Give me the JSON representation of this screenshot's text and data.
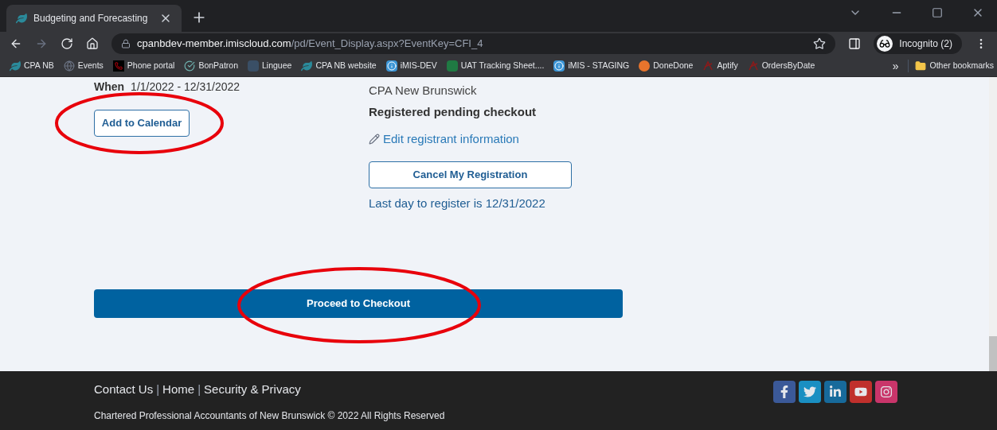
{
  "browser": {
    "tab_title": "Budgeting and Forecasting",
    "url_host": "cpanbdev-member.imiscloud.com",
    "url_path": "/pd/Event_Display.aspx?EventKey=CFI_4",
    "profile": "Incognito (2)"
  },
  "bookmarks": [
    {
      "label": "CPA NB",
      "kind": "leaf"
    },
    {
      "label": "Events",
      "kind": "globe"
    },
    {
      "label": "Phone portal",
      "kind": "phone"
    },
    {
      "label": "BonPatron",
      "kind": "check"
    },
    {
      "label": "Linguee",
      "kind": "linguee"
    },
    {
      "label": "CPA NB website",
      "kind": "leaf"
    },
    {
      "label": "iMIS-DEV",
      "kind": "info"
    },
    {
      "label": "UAT Tracking Sheet....",
      "kind": "excel"
    },
    {
      "label": "iMIS - STAGING",
      "kind": "info"
    },
    {
      "label": "DoneDone",
      "kind": "donedone"
    },
    {
      "label": "Aptify",
      "kind": "aptify"
    },
    {
      "label": "OrdersByDate",
      "kind": "aptify"
    }
  ],
  "bookmarks_overflow": "»",
  "other_bookmarks": "Other bookmarks",
  "event": {
    "when_label": "When",
    "when_value": "1/1/2022 - 12/31/2022",
    "add_to_calendar": "Add to Calendar",
    "organizer": "CPA New Brunswick",
    "status": "Registered pending checkout",
    "edit_link": "Edit registrant information",
    "cancel_button": "Cancel My Registration",
    "last_day": "Last day to register is 12/31/2022",
    "checkout_button": "Proceed to Checkout"
  },
  "footer": {
    "links": [
      "Contact Us",
      "Home",
      "Security & Privacy"
    ],
    "separator": "|",
    "copyright": "Chartered Professional Accountants of New Brunswick © 2022 All Rights Reserved",
    "social": [
      {
        "kind": "facebook",
        "color": "#3b5998"
      },
      {
        "kind": "twitter",
        "color": "#1a8fc2"
      },
      {
        "kind": "linkedin",
        "color": "#176a9b"
      },
      {
        "kind": "youtube",
        "color": "#c0302c"
      },
      {
        "kind": "instagram",
        "color": "#c9356a"
      }
    ]
  }
}
